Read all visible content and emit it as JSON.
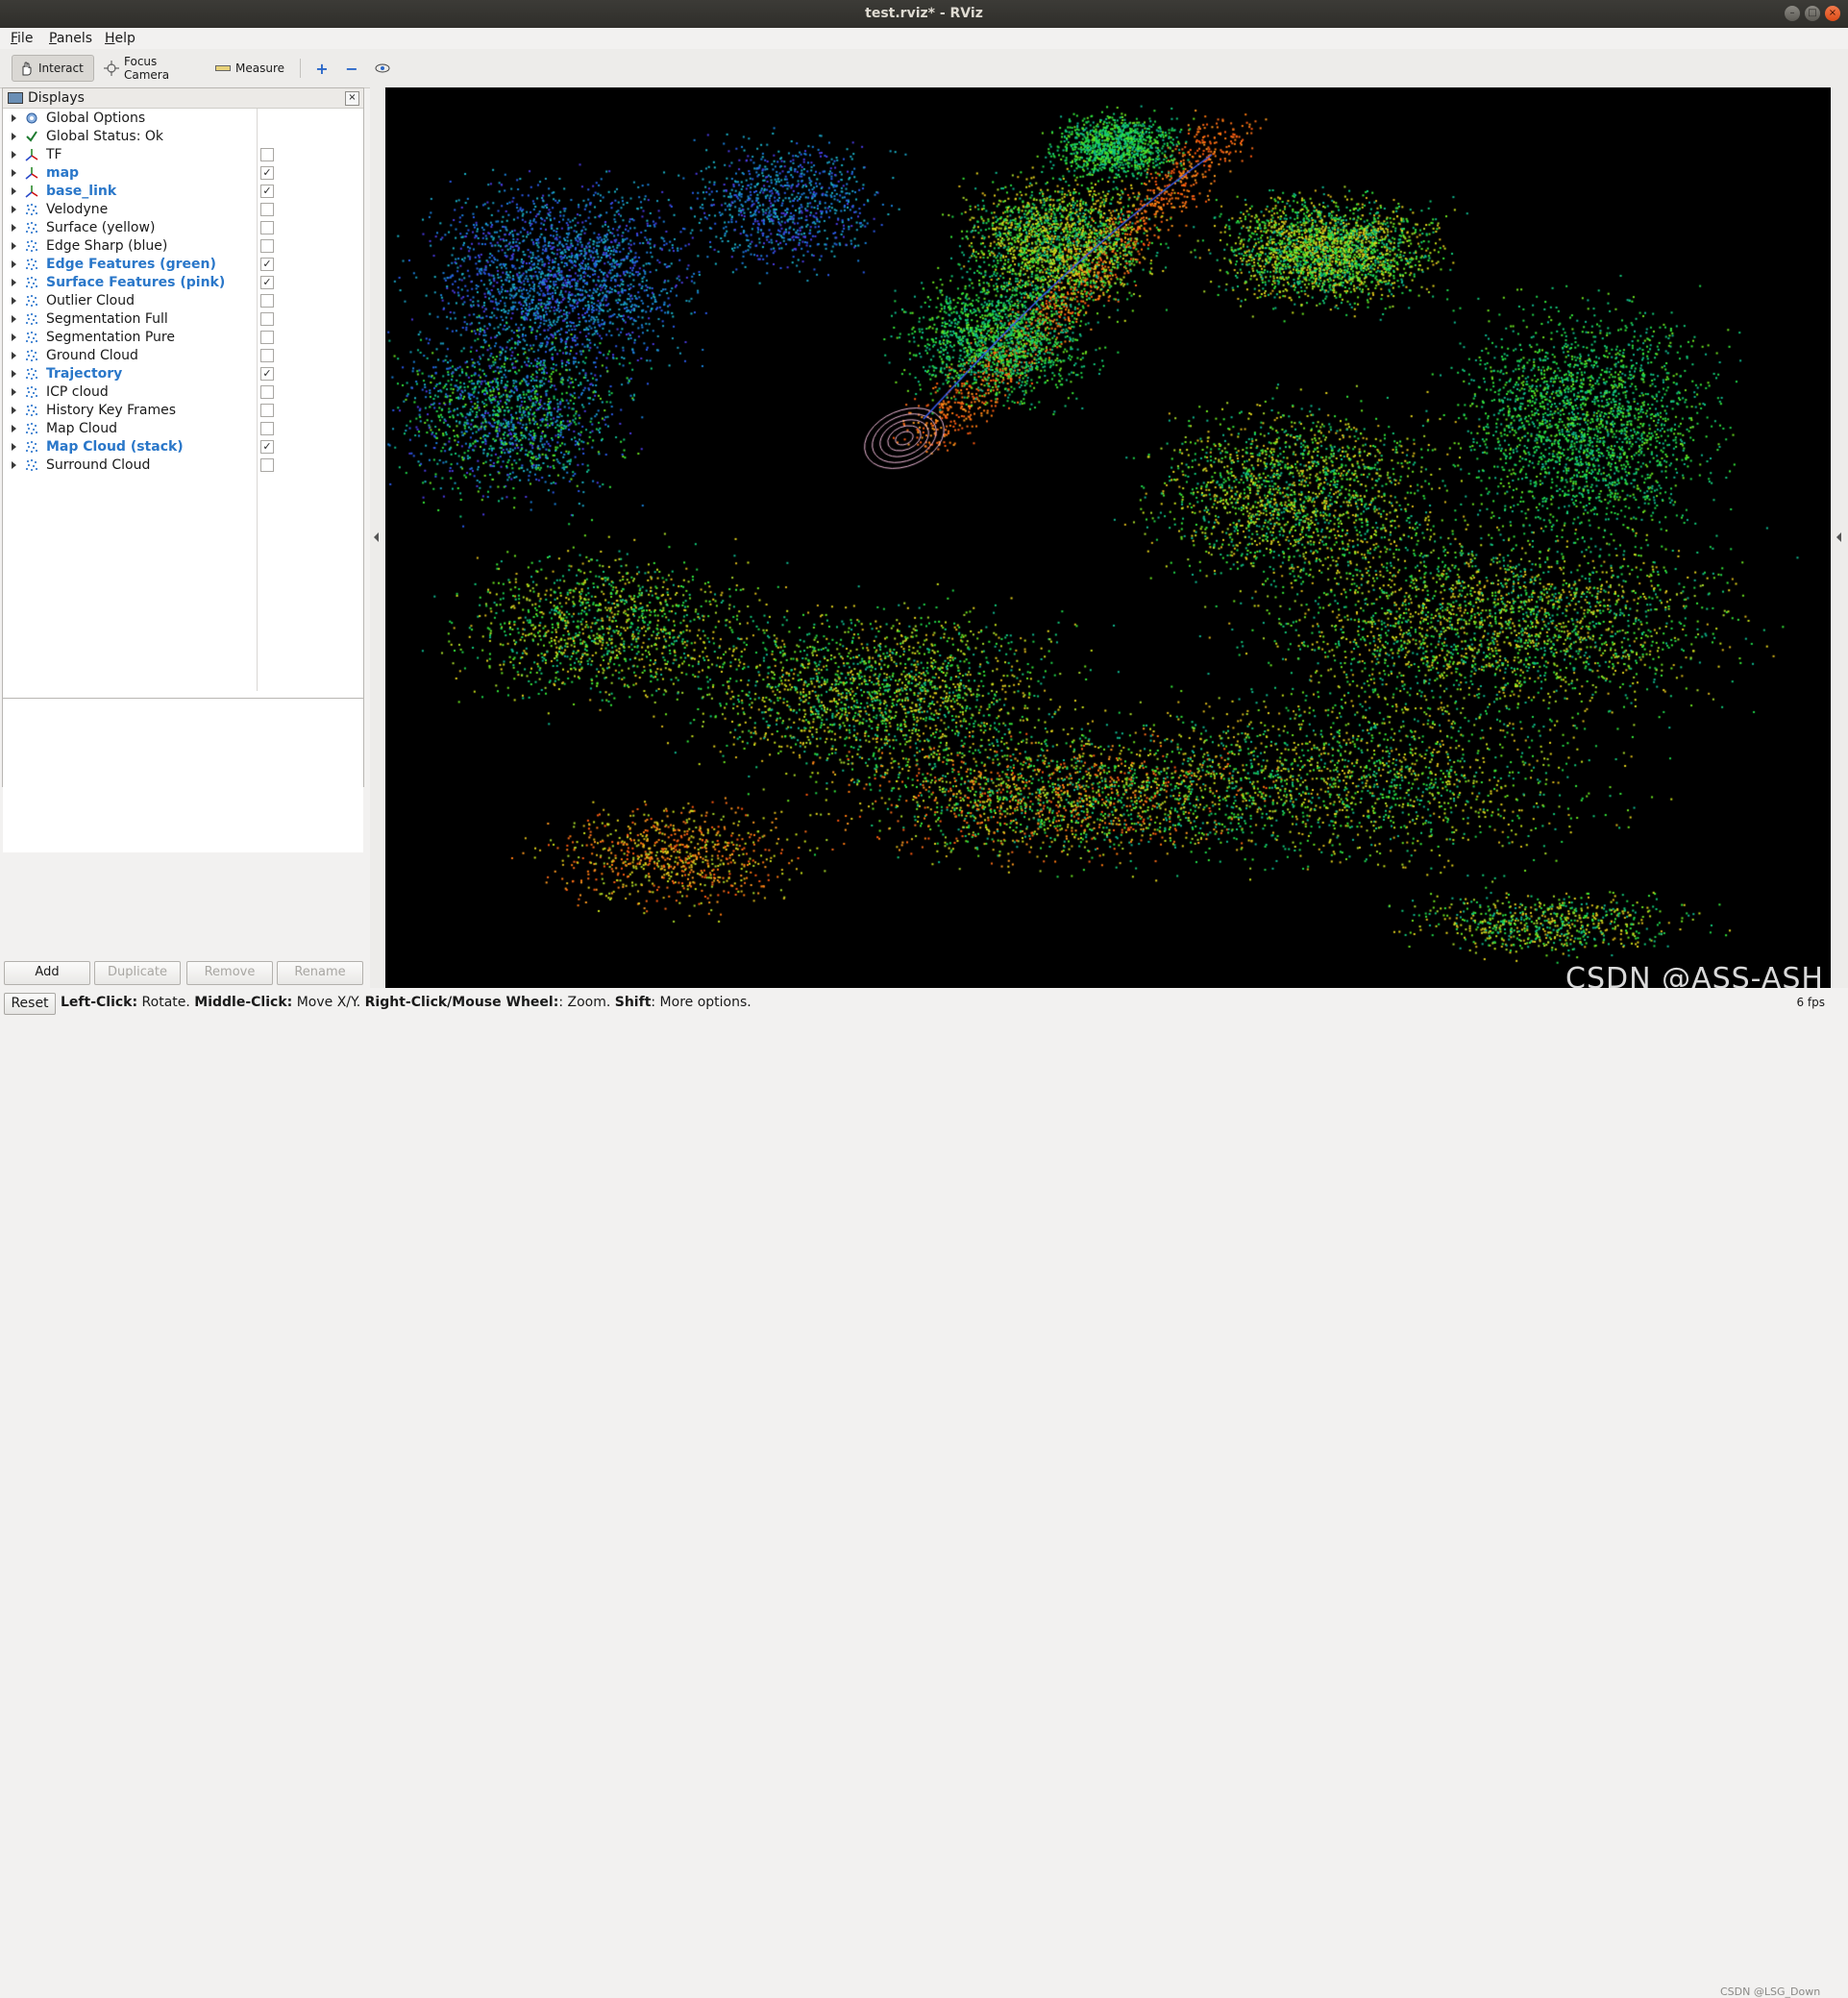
{
  "window": {
    "title": "test.rviz* - RViz",
    "controls": [
      "minimize",
      "maximize",
      "close"
    ]
  },
  "menu": [
    {
      "label": "File",
      "accel": "F",
      "rest": "ile"
    },
    {
      "label": "Panels",
      "accel": "P",
      "rest": "anels"
    },
    {
      "label": "Help",
      "accel": "H",
      "rest": "elp"
    }
  ],
  "toolbar": {
    "interact": "Interact",
    "focus_camera": "Focus Camera",
    "measure": "Measure",
    "icons": [
      "hand-icon",
      "crosshair-icon",
      "ruler-icon",
      "plus-icon",
      "minus-icon",
      "eye-icon"
    ]
  },
  "displays": {
    "title": "Displays",
    "items": [
      {
        "label": "Global Options",
        "icon": "gear-icon",
        "checkbox": null,
        "highlight": false
      },
      {
        "label": "Global Status: Ok",
        "icon": "check-icon",
        "checkbox": null,
        "highlight": false
      },
      {
        "label": "TF",
        "icon": "axes-icon",
        "checkbox": false,
        "highlight": false
      },
      {
        "label": "map",
        "icon": "axes-icon",
        "checkbox": true,
        "highlight": true
      },
      {
        "label": "base_link",
        "icon": "axes-icon",
        "checkbox": true,
        "highlight": true
      },
      {
        "label": "Velodyne",
        "icon": "pointcloud-icon",
        "checkbox": false,
        "highlight": false
      },
      {
        "label": "Surface (yellow)",
        "icon": "pointcloud-icon",
        "checkbox": false,
        "highlight": false
      },
      {
        "label": "Edge Sharp (blue)",
        "icon": "pointcloud-icon",
        "checkbox": false,
        "highlight": false
      },
      {
        "label": "Edge Features (green)",
        "icon": "pointcloud-icon",
        "checkbox": true,
        "highlight": true
      },
      {
        "label": "Surface Features (pink)",
        "icon": "pointcloud-icon",
        "checkbox": true,
        "highlight": true
      },
      {
        "label": "Outlier Cloud",
        "icon": "pointcloud-icon",
        "checkbox": false,
        "highlight": false
      },
      {
        "label": "Segmentation Full",
        "icon": "pointcloud-icon",
        "checkbox": false,
        "highlight": false
      },
      {
        "label": "Segmentation Pure",
        "icon": "pointcloud-icon",
        "checkbox": false,
        "highlight": false
      },
      {
        "label": "Ground Cloud",
        "icon": "pointcloud-icon",
        "checkbox": false,
        "highlight": false
      },
      {
        "label": "Trajectory",
        "icon": "pointcloud-icon",
        "checkbox": true,
        "highlight": true
      },
      {
        "label": "ICP cloud",
        "icon": "pointcloud-icon",
        "checkbox": false,
        "highlight": false
      },
      {
        "label": "History Key Frames",
        "icon": "pointcloud-icon",
        "checkbox": false,
        "highlight": false
      },
      {
        "label": "Map Cloud",
        "icon": "pointcloud-icon",
        "checkbox": false,
        "highlight": false
      },
      {
        "label": "Map Cloud (stack)",
        "icon": "pointcloud-icon",
        "checkbox": true,
        "highlight": true
      },
      {
        "label": "Surround Cloud",
        "icon": "pointcloud-icon",
        "checkbox": false,
        "highlight": false
      }
    ],
    "buttons": {
      "add": "Add",
      "duplicate": "Duplicate",
      "remove": "Remove",
      "rename": "Rename"
    }
  },
  "status": {
    "reset": "Reset",
    "hint": [
      {
        "b": "Left-Click:",
        "t": " Rotate. "
      },
      {
        "b": "Middle-Click:",
        "t": " Move X/Y. "
      },
      {
        "b": "Right-Click/Mouse Wheel:",
        "t": ": Zoom. "
      },
      {
        "b": "Shift",
        "t": ": More options."
      }
    ],
    "fps": "6 fps"
  },
  "watermark": {
    "main": "CSDN @ASS-ASH",
    "small": "CSDN @LSG_Down"
  },
  "colors": {
    "highlight": "#2a77c9",
    "viewport_bg": "#000000",
    "titlebar": "#3c3b37"
  }
}
